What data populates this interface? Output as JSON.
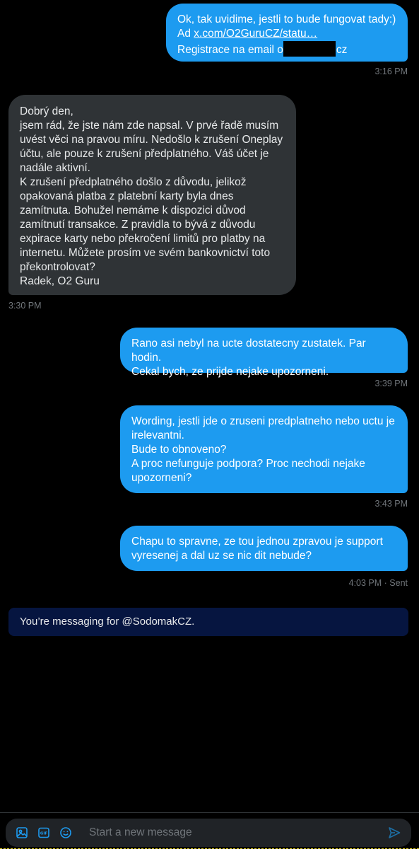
{
  "messages": [
    {
      "direction": "outgoing",
      "lines": [
        "Ok, tak uvidime, jestli to bude fungovat tady:)"
      ],
      "link_prefix": "Ad ",
      "link_text": "x.com/O2GuruCZ/statu…",
      "email_prefix": "Registrace na email o",
      "email_suffix": "cz",
      "timestamp": "3:16 PM"
    },
    {
      "direction": "incoming",
      "text": "Dobrý den,\njsem rád, že jste nám zde napsal. V prvé řadě musím\nuvést věci na pravou míru. Nedošlo k zrušení Oneplay\núčtu, ale pouze k zrušení předplatného. Váš účet je\nnadále aktivní.\nK zrušení předplatného došlo z důvodu, jelikož\nopakovaná platba z platební karty byla dnes\nzamítnuta. Bohužel nemáme k dispozici důvod\nzamítnutí transakce. Z pravidla to bývá z důvodu\nexpirace karty nebo překročení limitů pro platby na\ninternetu. Můžete prosím ve svém bankovnictví toto\npřekontrolovat?\nRadek, O2 Guru",
      "timestamp": "3:30 PM"
    },
    {
      "direction": "outgoing",
      "text": "Rano asi nebyl na ucte dostatecny zustatek. Par hodin.\nCekal bych, ze prijde nejake upozorneni.",
      "timestamp": "3:39 PM"
    },
    {
      "direction": "outgoing",
      "text": "Wording, jestli jde o zruseni predplatneho nebo uctu je\nirelevantni.\nBude to obnoveno?\nA proc nefunguje podpora? Proc nechodi nejake\nupozorneni?",
      "timestamp": "3:43 PM"
    },
    {
      "direction": "outgoing",
      "text": "Chapu to spravne, ze tou jednou zpravou je support\nvyresenej a dal uz se nic dit nebude?",
      "timestamp": "4:03 PM · Sent"
    }
  ],
  "notice": "You’re messaging for @SodomakCZ.",
  "composer": {
    "placeholder": "Start a new message",
    "tools": [
      "media-icon",
      "gif-icon",
      "emoji-icon"
    ],
    "send_icon": "send-icon"
  },
  "colors": {
    "outgoing_bubble": "#1d9bf0",
    "incoming_bubble": "#2f3336",
    "notice_background": "#061540",
    "timestamp": "#71767b",
    "background": "#000000"
  }
}
